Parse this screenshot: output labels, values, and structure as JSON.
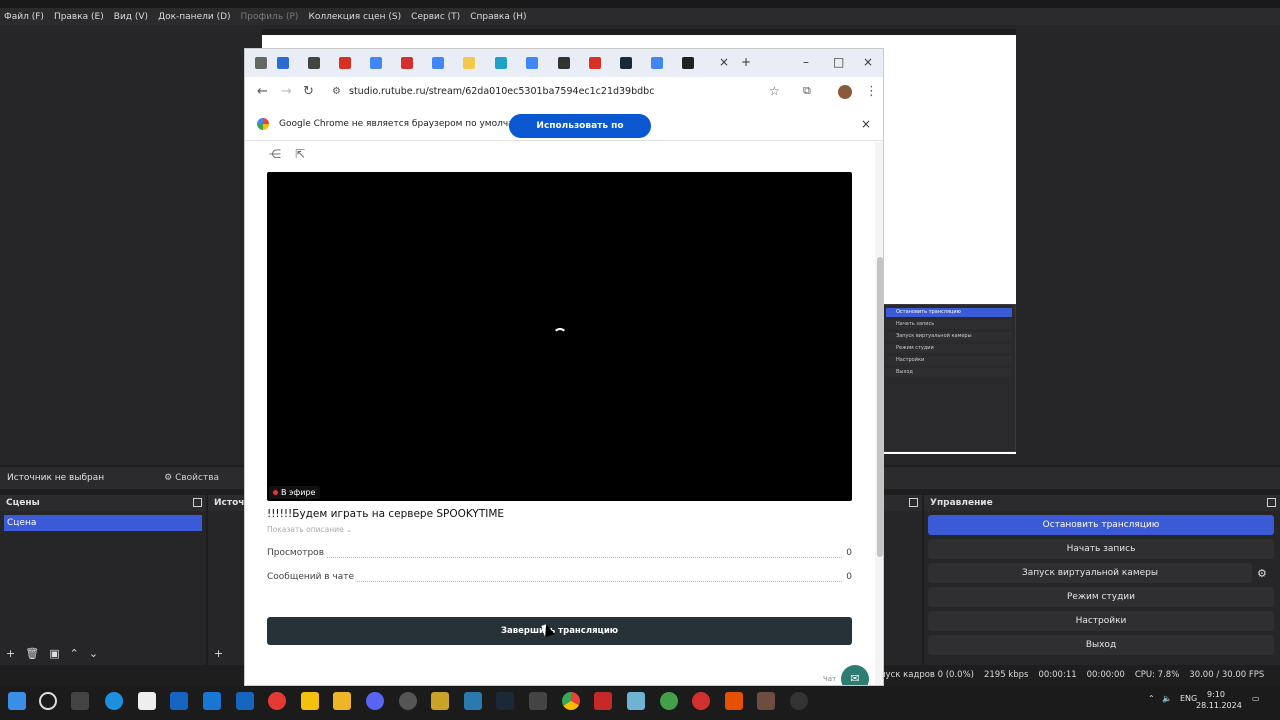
{
  "obs": {
    "menu": [
      "Файл (F)",
      "Правка (E)",
      "Вид (V)",
      "Док-панели (D)",
      "Профиль (P)",
      "Коллекция сцен (S)",
      "Сервис (T)",
      "Справка (H)"
    ],
    "source_status": "Источник не выбран",
    "properties_label": "Свойства",
    "scenes_title": "Сцены",
    "scene_selected": "Сцена",
    "sources_title": "Источ",
    "controls_title": "Управление",
    "controls": [
      {
        "label": "Остановить трансляцию",
        "active": true
      },
      {
        "label": "Начать запись",
        "active": false
      },
      {
        "label": "Запуск виртуальной камеры",
        "active": false
      },
      {
        "label": "Режим студии",
        "active": false
      },
      {
        "label": "Настройки",
        "active": false
      },
      {
        "label": "Выход",
        "active": false
      }
    ],
    "status": {
      "dropped": "пуск кадров 0 (0.0%)",
      "bitrate": "2195 kbps",
      "stream_time": "00:00:11",
      "rec_time": "00:00:00",
      "cpu": "CPU: 7.8%",
      "fps": "30.00 / 30.00 FPS"
    }
  },
  "chrome": {
    "url": "studio.rutube.ru/stream/62da010ec5301ba7594ec1c21d39bdbc",
    "infobar_message": "Google Chrome не является браузером по умолчанию.",
    "infobar_button": "Использовать по умолчанию"
  },
  "page": {
    "live_badge": "В эфире",
    "title": "!!!!!!Будем играть на сервере SPOOKYTIME",
    "show_description": "Показать описание",
    "stats": [
      {
        "label": "Просмотров",
        "value": "0"
      },
      {
        "label": "Сообщений в чате",
        "value": "0"
      }
    ],
    "end_button": "Завершить трансляцию",
    "chat_label": "Чат"
  },
  "taskbar": {
    "lang": "ENG",
    "time": "9:10",
    "date": "28.11.2024"
  },
  "colors": {
    "obs_accent": "#3b5bd6",
    "chrome_button": "#0b57d0",
    "end_button": "#263238"
  }
}
